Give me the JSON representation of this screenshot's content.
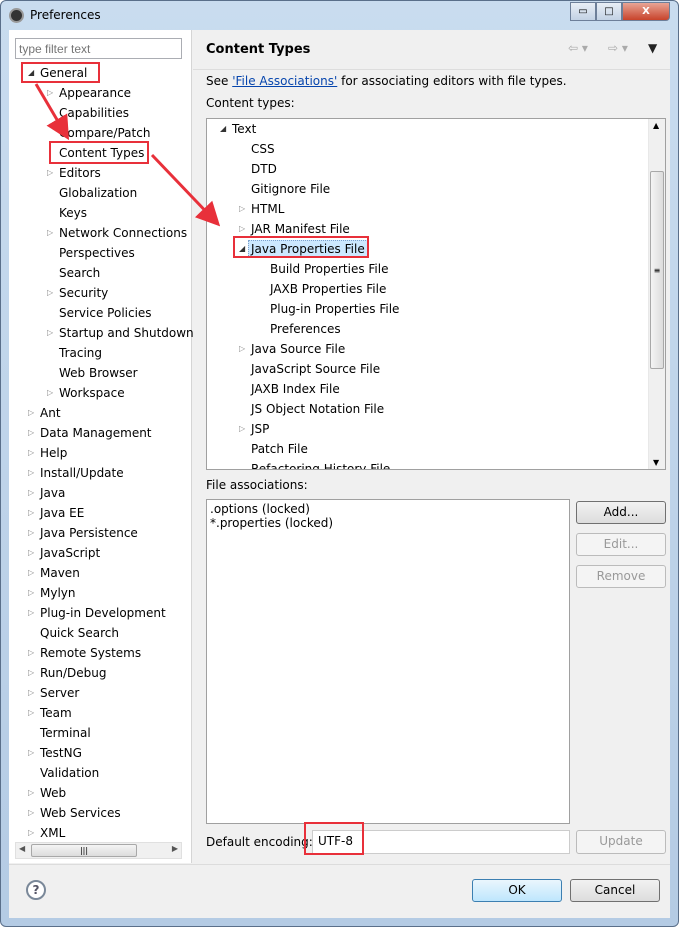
{
  "window": {
    "title": "Preferences",
    "min": "▭",
    "max": "□",
    "close": "X"
  },
  "filter": {
    "placeholder": "type filter text"
  },
  "left_tree": [
    {
      "label": "General",
      "level": 0,
      "arrow": "expanded"
    },
    {
      "label": "Appearance",
      "level": 1,
      "arrow": "collapsed"
    },
    {
      "label": "Capabilities",
      "level": 1,
      "arrow": "none"
    },
    {
      "label": "Compare/Patch",
      "level": 1,
      "arrow": "none"
    },
    {
      "label": "Content Types",
      "level": 1,
      "arrow": "none"
    },
    {
      "label": "Editors",
      "level": 1,
      "arrow": "collapsed"
    },
    {
      "label": "Globalization",
      "level": 1,
      "arrow": "none"
    },
    {
      "label": "Keys",
      "level": 1,
      "arrow": "none"
    },
    {
      "label": "Network Connections",
      "level": 1,
      "arrow": "collapsed"
    },
    {
      "label": "Perspectives",
      "level": 1,
      "arrow": "none"
    },
    {
      "label": "Search",
      "level": 1,
      "arrow": "none"
    },
    {
      "label": "Security",
      "level": 1,
      "arrow": "collapsed"
    },
    {
      "label": "Service Policies",
      "level": 1,
      "arrow": "none"
    },
    {
      "label": "Startup and Shutdown",
      "level": 1,
      "arrow": "collapsed"
    },
    {
      "label": "Tracing",
      "level": 1,
      "arrow": "none"
    },
    {
      "label": "Web Browser",
      "level": 1,
      "arrow": "none"
    },
    {
      "label": "Workspace",
      "level": 1,
      "arrow": "collapsed"
    },
    {
      "label": "Ant",
      "level": 0,
      "arrow": "collapsed"
    },
    {
      "label": "Data Management",
      "level": 0,
      "arrow": "collapsed"
    },
    {
      "label": "Help",
      "level": 0,
      "arrow": "collapsed"
    },
    {
      "label": "Install/Update",
      "level": 0,
      "arrow": "collapsed"
    },
    {
      "label": "Java",
      "level": 0,
      "arrow": "collapsed"
    },
    {
      "label": "Java EE",
      "level": 0,
      "arrow": "collapsed"
    },
    {
      "label": "Java Persistence",
      "level": 0,
      "arrow": "collapsed"
    },
    {
      "label": "JavaScript",
      "level": 0,
      "arrow": "collapsed"
    },
    {
      "label": "Maven",
      "level": 0,
      "arrow": "collapsed"
    },
    {
      "label": "Mylyn",
      "level": 0,
      "arrow": "collapsed"
    },
    {
      "label": "Plug-in Development",
      "level": 0,
      "arrow": "collapsed"
    },
    {
      "label": "Quick Search",
      "level": 0,
      "arrow": "none"
    },
    {
      "label": "Remote Systems",
      "level": 0,
      "arrow": "collapsed"
    },
    {
      "label": "Run/Debug",
      "level": 0,
      "arrow": "collapsed"
    },
    {
      "label": "Server",
      "level": 0,
      "arrow": "collapsed"
    },
    {
      "label": "Team",
      "level": 0,
      "arrow": "collapsed"
    },
    {
      "label": "Terminal",
      "level": 0,
      "arrow": "none"
    },
    {
      "label": "TestNG",
      "level": 0,
      "arrow": "collapsed"
    },
    {
      "label": "Validation",
      "level": 0,
      "arrow": "none"
    },
    {
      "label": "Web",
      "level": 0,
      "arrow": "collapsed"
    },
    {
      "label": "Web Services",
      "level": 0,
      "arrow": "collapsed"
    },
    {
      "label": "XML",
      "level": 0,
      "arrow": "collapsed"
    }
  ],
  "page": {
    "title": "Content Types",
    "desc_prefix": "See ",
    "desc_link": "'File Associations'",
    "desc_suffix": " for associating editors with file types.",
    "content_types_label": "Content types:",
    "content_tree": [
      {
        "label": "Text",
        "level": 0,
        "arrow": "expanded"
      },
      {
        "label": "CSS",
        "level": 1,
        "arrow": "none"
      },
      {
        "label": "DTD",
        "level": 1,
        "arrow": "none"
      },
      {
        "label": "Gitignore File",
        "level": 1,
        "arrow": "none"
      },
      {
        "label": "HTML",
        "level": 1,
        "arrow": "collapsed"
      },
      {
        "label": "JAR Manifest File",
        "level": 1,
        "arrow": "collapsed"
      },
      {
        "label": "Java Properties File",
        "level": 1,
        "arrow": "expanded",
        "selected": true
      },
      {
        "label": "Build Properties File",
        "level": 2,
        "arrow": "none"
      },
      {
        "label": "JAXB Properties File",
        "level": 2,
        "arrow": "none"
      },
      {
        "label": "Plug-in Properties File",
        "level": 2,
        "arrow": "none"
      },
      {
        "label": "Preferences",
        "level": 2,
        "arrow": "none"
      },
      {
        "label": "Java Source File",
        "level": 1,
        "arrow": "collapsed"
      },
      {
        "label": "JavaScript Source File",
        "level": 1,
        "arrow": "none"
      },
      {
        "label": "JAXB Index File",
        "level": 1,
        "arrow": "none"
      },
      {
        "label": "JS Object Notation File",
        "level": 1,
        "arrow": "none"
      },
      {
        "label": "JSP",
        "level": 1,
        "arrow": "collapsed"
      },
      {
        "label": "Patch File",
        "level": 1,
        "arrow": "none"
      },
      {
        "label": "Refactoring History File",
        "level": 1,
        "arrow": "none"
      }
    ],
    "file_assoc_label": "File associations:",
    "file_assoc": [
      ".options (locked)",
      "*.properties (locked)"
    ],
    "buttons": {
      "add": "Add...",
      "edit": "Edit...",
      "remove": "Remove",
      "update": "Update"
    },
    "encoding_label": "Default encoding:",
    "encoding_value": "UTF-8"
  },
  "footer": {
    "help": "?",
    "ok": "OK",
    "cancel": "Cancel"
  },
  "annotation_color": "#e8303a"
}
